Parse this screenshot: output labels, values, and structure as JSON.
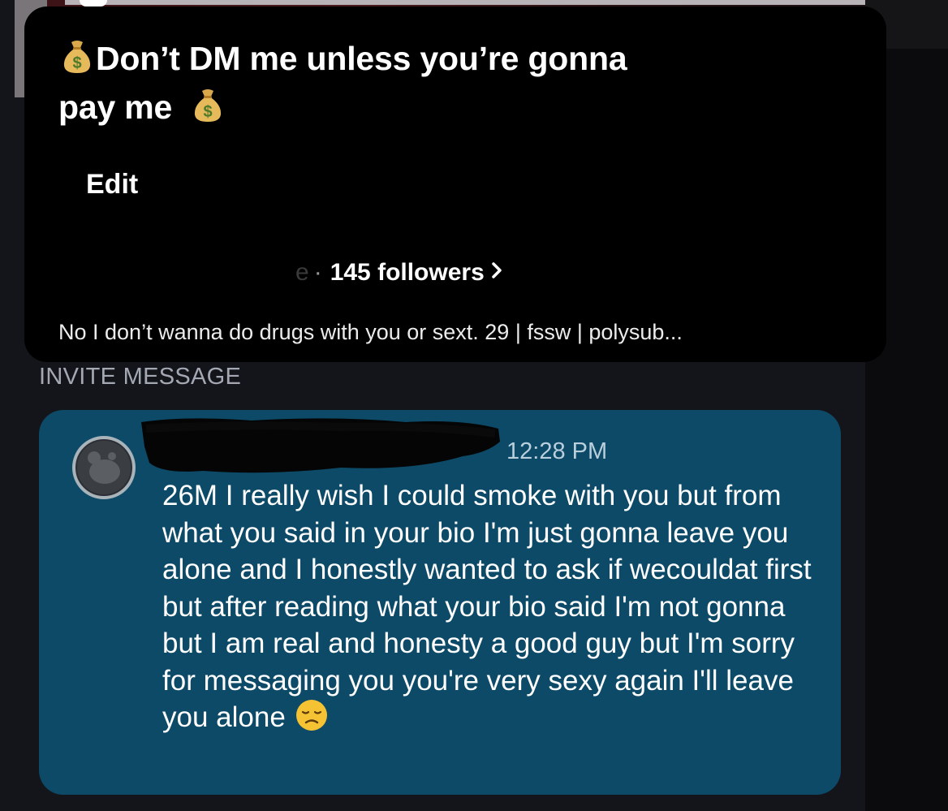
{
  "profile": {
    "display_name_line1": "Don’t DM me unless you’re gonna",
    "display_name_line2": "pay me",
    "edit_label": "Edit",
    "stats_prefix_cut": "e",
    "followers_text": "145 followers",
    "bio": "No I don’t wanna do drugs with you or sext.  29 | fssw | polysub...",
    "title_emoji_icon": "money-bag-icon"
  },
  "invite": {
    "section_label": "INVITE MESSAGE",
    "time": "12:28 PM",
    "message": "26M I really wish I could smoke with you but from what you said in your bio I'm just gonna leave you alone and I honestly wanted to ask if wecouldat first but after reading what your bio said I'm not gonna but I am real and honesty a good guy but I'm sorry for messaging you you're very sexy again I'll leave you alone",
    "trailing_emoji_icon": "disappointed-face-icon"
  },
  "colors": {
    "card_bg": "#000000",
    "bubble_bg": "#0c4a68",
    "page_bg": "#14151b",
    "section_label": "#a4a8b3"
  }
}
